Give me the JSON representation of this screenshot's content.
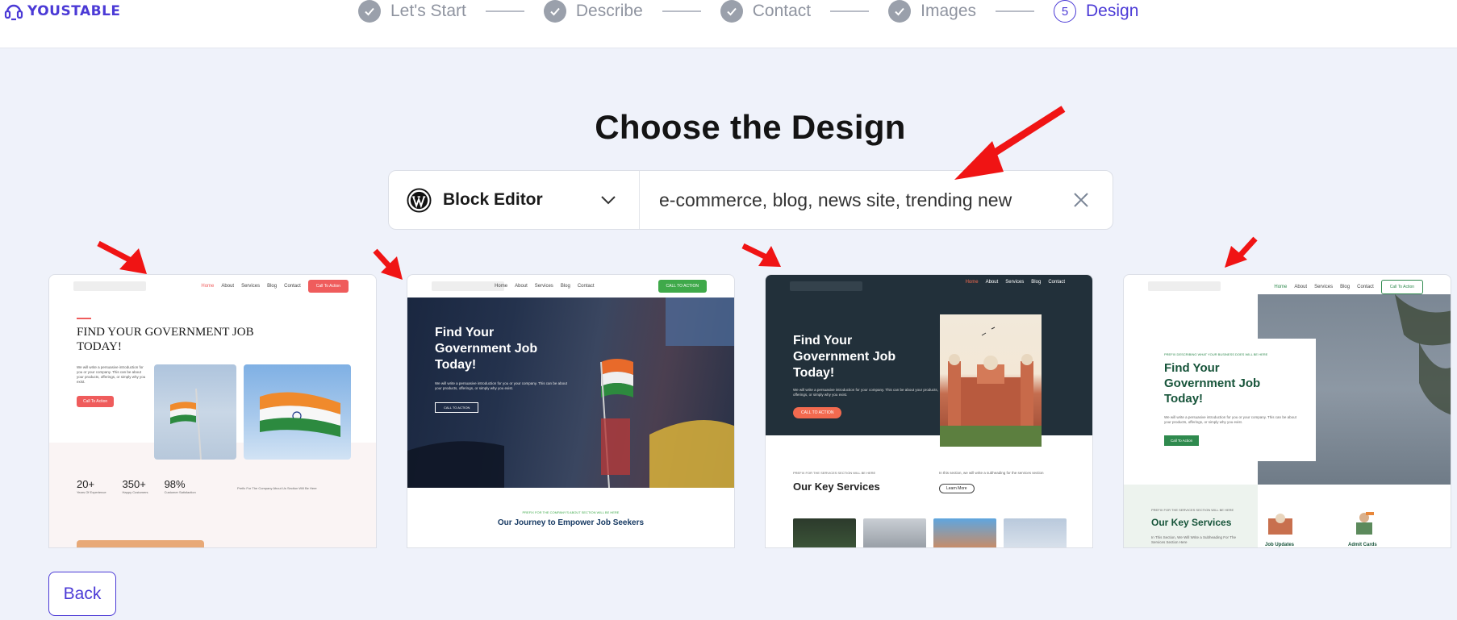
{
  "brand": {
    "name": "YOUSTABLE",
    "color": "#4b3ad6"
  },
  "steps": [
    {
      "label": "Let's Start",
      "state": "done"
    },
    {
      "label": "Describe",
      "state": "done"
    },
    {
      "label": "Contact",
      "state": "done"
    },
    {
      "label": "Images",
      "state": "done"
    },
    {
      "label": "Design",
      "number": "5",
      "state": "active"
    }
  ],
  "main": {
    "title": "Choose the Design",
    "editor_select": {
      "label": "Block Editor",
      "icon": "wordpress-icon"
    },
    "search": {
      "value": "e-commerce, blog, news site, trending new"
    }
  },
  "templates": [
    {
      "nav": [
        "Home",
        "About",
        "Services",
        "Blog",
        "Contact"
      ],
      "nav_button": "Call To Action",
      "headline": "FIND YOUR GOVERNMENT JOB TODAY!",
      "body": "We will write a persuasive introduction for you or your company. This can be about your products, offerings, or simply why you exist.",
      "cta": "Call To Action",
      "stats": [
        {
          "value": "20+",
          "label": "Years Of Experience"
        },
        {
          "value": "350+",
          "label": "Happy Customers"
        },
        {
          "value": "98%",
          "label": "Customer Satisfaction"
        }
      ],
      "prefix": "Prefix For The Company About Us Section Will Be Here"
    },
    {
      "nav": [
        "Home",
        "About",
        "Services",
        "Blog",
        "Contact"
      ],
      "nav_button": "CALL TO ACTION",
      "headline": "Find Your Government Job Today!",
      "body": "We will write a persuasive introduction for you or your company. This can be about your products, offerings, or simply why you exist.",
      "cta": "CALL TO ACTION",
      "prefix": "PREFIX FOR THE COMPANY'S ABOUT SECTION WILL BE HERE",
      "section_title": "Our Journey to Empower Job Seekers"
    },
    {
      "nav": [
        "Home",
        "About",
        "Services",
        "Blog",
        "Contact"
      ],
      "headline": "Find Your Government Job Today!",
      "body": "We will write a persuasive introduction for your company. This can be about your products, offerings, or simply why you exist.",
      "cta": "CALL TO ACTION",
      "prefix": "PREFIX FOR THE SERVICES SECTION WILL BE HERE",
      "section_title": "Our Key Services",
      "section_desc": "In this section, we will write a subheading for the services section",
      "learn_more": "Learn More"
    },
    {
      "nav": [
        "Home",
        "About",
        "Services",
        "Blog",
        "Contact"
      ],
      "nav_button": "Call To Action",
      "prefix": "PREFIX DESCRIBING WHAT YOUR BUSINESS DOES WILL BE HERE",
      "headline": "Find Your Government Job Today!",
      "body": "We will write a persuasive introduction for you or your company. This can be about your products, offerings, or simply why you exist.",
      "cta": "Call To Action",
      "prefix2": "PREFIX FOR THE SERVICES SECTION WILL BE HERE",
      "section_title": "Our Key Services",
      "section_desc": "In This Section, We Will Write a Subheading For The Services Section Here",
      "services": [
        "Job Updates",
        "Admit Cards"
      ]
    }
  ],
  "footer": {
    "back_label": "Back"
  }
}
